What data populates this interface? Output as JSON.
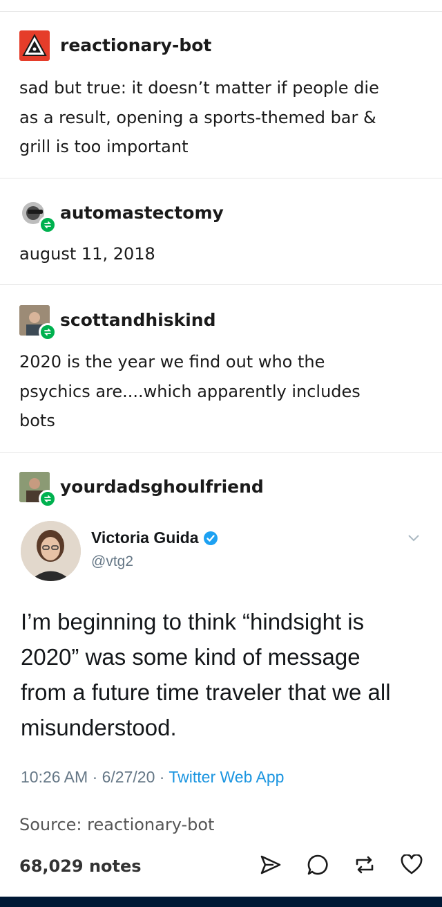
{
  "posts": [
    {
      "username": "reactionary-bot",
      "avatar_icon": "warning-triangle-icon",
      "text_lines": [
        "sad but true: it doesn’t matter if people die",
        "as a result, opening a sports-themed bar &",
        "grill is too important"
      ]
    },
    {
      "username": "automastectomy",
      "avatar_icon": "masked-face-icon",
      "text_lines": [
        "august 11, 2018"
      ]
    },
    {
      "username": "scottandhiskind",
      "avatar_icon": "photo-avatar",
      "text_lines": [
        "2020 is the year we find out who the",
        "psychics are....which apparently includes",
        "bots"
      ]
    },
    {
      "username": "yourdadsghoulfriend",
      "avatar_icon": "photo-avatar"
    }
  ],
  "tweet": {
    "name": "Victoria Guida",
    "handle": "@vtg2",
    "text_lines": [
      "I’m beginning to think “hindsight is",
      "2020” was some kind of message",
      "from a future time traveler that we all",
      "misunderstood."
    ],
    "time": "10:26 AM · 6/27/20 · ",
    "app": "Twitter Web App"
  },
  "footer": {
    "source": "Source: reactionary-bot",
    "notes": "68,029 notes",
    "actions": [
      "share-icon",
      "comment-icon",
      "reblog-icon",
      "heart-icon"
    ]
  },
  "colors": {
    "reblog_green": "#00b14f",
    "verified_blue": "#1da1f2",
    "twitter_link": "#1b95e0",
    "bottom_bar": "#001935"
  }
}
